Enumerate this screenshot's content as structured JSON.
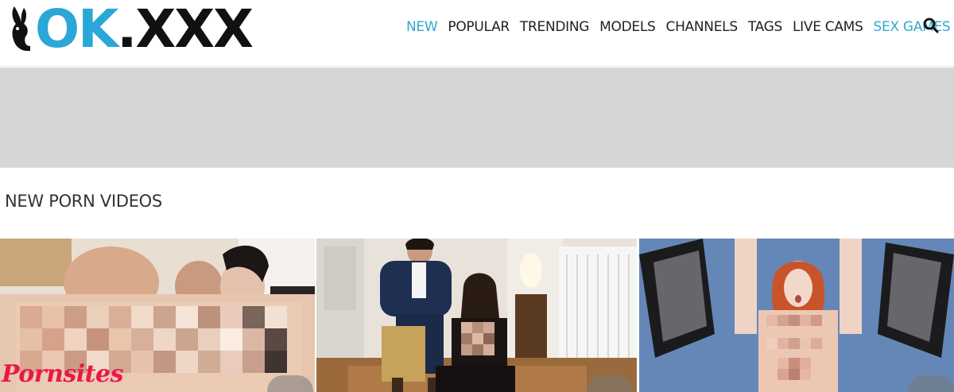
{
  "header": {
    "logo_prefix": "OK",
    "logo_suffix": ".XXX",
    "nav": [
      {
        "label": "NEW",
        "accent": true
      },
      {
        "label": "POPULAR",
        "accent": false
      },
      {
        "label": "TRENDING",
        "accent": false
      },
      {
        "label": "MODELS",
        "accent": false
      },
      {
        "label": "CHANNELS",
        "accent": false
      },
      {
        "label": "TAGS",
        "accent": false
      },
      {
        "label": "LIVE CAMS",
        "accent": false
      },
      {
        "label": "SEX GAMES",
        "accent": true
      }
    ],
    "search_icon": "search-icon"
  },
  "main": {
    "section_title": "NEW PORN VIDEOS"
  },
  "watermark": "Pornsites",
  "colors": {
    "accent": "#33a9c9",
    "logo_blue": "#2aa7d6",
    "banner_gray": "#d6d6d6",
    "watermark_red": "#e8184a"
  }
}
